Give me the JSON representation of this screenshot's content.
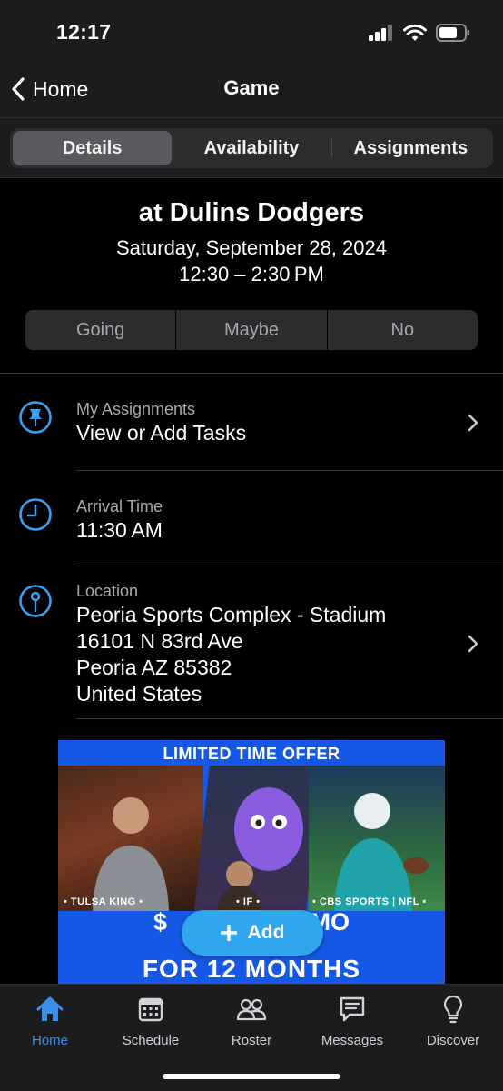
{
  "status_bar": {
    "time": "12:17"
  },
  "nav": {
    "back_label": "Home",
    "title": "Game"
  },
  "tabs": {
    "details": "Details",
    "availability": "Availability",
    "assignments": "Assignments"
  },
  "game": {
    "title": "at Dulins Dodgers",
    "date": "Saturday, September 28, 2024",
    "time": "12:30 – 2:30 PM"
  },
  "rsvp": {
    "going": "Going",
    "maybe": "Maybe",
    "no": "No"
  },
  "assignments": {
    "label": "My Assignments",
    "value": "View or Add Tasks"
  },
  "arrival": {
    "label": "Arrival Time",
    "value": "11:30 AM"
  },
  "location": {
    "label": "Location",
    "lines": [
      "Peoria Sports Complex - Stadium",
      "16101 N 83rd Ave",
      "Peoria AZ 85382",
      "United States"
    ]
  },
  "ad": {
    "headline": "LIMITED TIME OFFER",
    "captions": [
      "• TULSA KING •",
      "• IF •",
      "• CBS SPORTS | NFL •"
    ],
    "price_left": "$",
    "price_right": "/MO",
    "subline": "FOR 12 MONTHS"
  },
  "add_button": {
    "label": "Add"
  },
  "tab_bar": {
    "items": [
      {
        "label": "Home",
        "icon": "house-icon",
        "active": true
      },
      {
        "label": "Schedule",
        "icon": "calendar-icon",
        "active": false
      },
      {
        "label": "Roster",
        "icon": "people-icon",
        "active": false
      },
      {
        "label": "Messages",
        "icon": "message-icon",
        "active": false
      },
      {
        "label": "Discover",
        "icon": "lightbulb-icon",
        "active": false
      }
    ]
  },
  "colors": {
    "accent": "#3d8ee8",
    "add_button": "#2fa6ee",
    "ad_blue": "#1658e6",
    "row_icon": "#3aa0ee"
  }
}
